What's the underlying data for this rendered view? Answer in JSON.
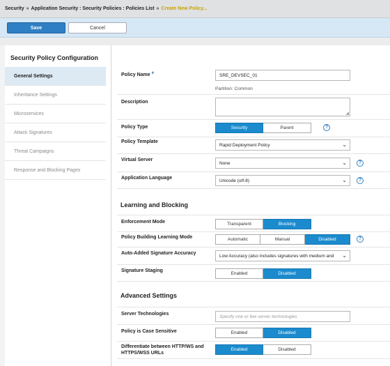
{
  "breadcrumb": {
    "items": [
      "Security",
      "Application Security : Security Policies : Policies List"
    ],
    "active": "Create New Policy...",
    "separator": "»"
  },
  "actions": {
    "save": "Save",
    "cancel": "Cancel"
  },
  "sidebar": {
    "title": "Security Policy Configuration",
    "items": [
      {
        "label": "General Settings",
        "active": true
      },
      {
        "label": "Inheritance Settings"
      },
      {
        "label": "Microservices"
      },
      {
        "label": "Attack Signatures"
      },
      {
        "label": "Threat Campaigns"
      },
      {
        "label": "Response and Blocking Pages"
      }
    ]
  },
  "general": {
    "policy_name": {
      "label": "Policy Name",
      "required_mark": "*",
      "value": "SRE_DEVSEC_01",
      "partition": "Partition: Common"
    },
    "description": {
      "label": "Description",
      "value": ""
    },
    "policy_type": {
      "label": "Policy Type",
      "options": [
        "Security",
        "Parent"
      ],
      "selected": "Security"
    },
    "policy_template": {
      "label": "Policy Template",
      "value": "Rapid Deployment Policy"
    },
    "virtual_server": {
      "label": "Virtual Server",
      "value": "None"
    },
    "app_language": {
      "label": "Application Language",
      "value": "Unicode (utf-8)"
    }
  },
  "learning": {
    "title": "Learning and Blocking",
    "enforcement": {
      "label": "Enforcement Mode",
      "options": [
        "Transparent",
        "Blocking"
      ],
      "selected": "Blocking"
    },
    "building_mode": {
      "label": "Policy Building Learning Mode",
      "options": [
        "Automatic",
        "Manual",
        "Disabled"
      ],
      "selected": "Disabled"
    },
    "signature_accuracy": {
      "label": "Auto-Added Signature Accuracy",
      "value": "Low Accuracy (also includes signatures with medium and"
    },
    "signature_staging": {
      "label": "Signature Staging",
      "options": [
        "Enabled",
        "Disabled"
      ],
      "selected": "Disabled"
    }
  },
  "advanced": {
    "title": "Advanced Settings",
    "server_tech": {
      "label": "Server Technologies",
      "placeholder": "Specify one or few server technologies"
    },
    "case_sensitive": {
      "label": "Policy is Case Sensitive",
      "options": [
        "Enabled",
        "Disabled"
      ],
      "selected": "Disabled"
    },
    "differentiate": {
      "label_line1": "Differentiate between HTTP/WS and",
      "label_line2": "HTTPS/WSS URLs",
      "options": [
        "Enabled",
        "Disabled"
      ],
      "selected": "Enabled"
    }
  },
  "icons": {
    "help": "question-circle-icon",
    "dropdown": "chevron-down-icon"
  },
  "colors": {
    "accent": "#1b8bce",
    "active_breadcrumb": "#c9a400",
    "sidebar_active": "#dde9f3"
  }
}
